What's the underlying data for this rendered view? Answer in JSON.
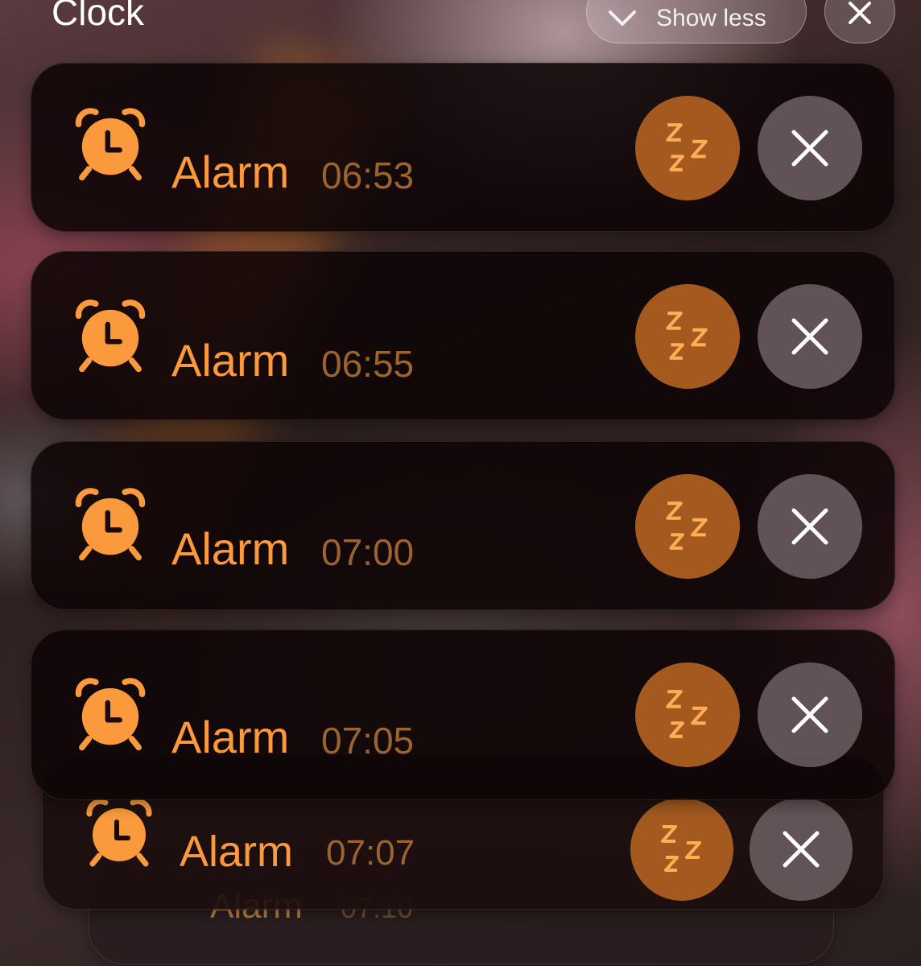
{
  "header": {
    "app_title": "Clock",
    "show_less_label": "Show less"
  },
  "notifications": [
    {
      "title": "Alarm",
      "time": "06:53"
    },
    {
      "title": "Alarm",
      "time": "06:55"
    },
    {
      "title": "Alarm",
      "time": "07:00"
    },
    {
      "title": "Alarm",
      "time": "07:05"
    },
    {
      "title": "Alarm",
      "time": "07:07"
    },
    {
      "title": "Alarm",
      "time": "07:10"
    }
  ],
  "icons": {
    "app": "alarm-clock-icon",
    "snooze": "zzz-icon",
    "dismiss": "close-icon",
    "collapse": "chevron-down-icon"
  },
  "colors": {
    "accent": "#fb9a3c",
    "time_text": "#9a6330",
    "snooze_bg": "#a45a1f",
    "dismiss_bg": "#6e5f64"
  }
}
